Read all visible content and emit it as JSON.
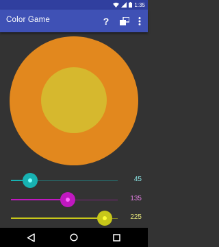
{
  "status_bar": {
    "time": "1:35",
    "icons": [
      "wifi-icon",
      "signal-icon",
      "battery-icon"
    ]
  },
  "app_bar": {
    "title": "Color Game",
    "actions": [
      {
        "name": "help-button",
        "icon": "question-mark-icon",
        "label": "?"
      },
      {
        "name": "swap-mode-button",
        "icon": "swap-icon"
      },
      {
        "name": "overflow-menu-button",
        "icon": "more-vert-icon"
      }
    ]
  },
  "colors": {
    "background": "#333333",
    "status_bar": "#303f9f",
    "app_bar": "#3f51b5",
    "outer_circle": "#e2881e",
    "inner_circle": "#d6b82e"
  },
  "sliders": [
    {
      "id": "cyan",
      "value": "45",
      "fraction": 0.18,
      "color": "#17b2b2",
      "knob": "#7fffff",
      "value_color": "#8ee8e8"
    },
    {
      "id": "magenta",
      "value": "135",
      "fraction": 0.53,
      "color": "#c018c0",
      "knob": "#ff6bff",
      "value_color": "#e27ee2"
    },
    {
      "id": "yellow",
      "value": "225",
      "fraction": 0.88,
      "color": "#c7c71a",
      "knob": "#fcfc36",
      "value_color": "#e4e47a"
    }
  ],
  "nav_bar": {
    "buttons": [
      "back-icon",
      "home-icon",
      "recents-icon"
    ]
  }
}
